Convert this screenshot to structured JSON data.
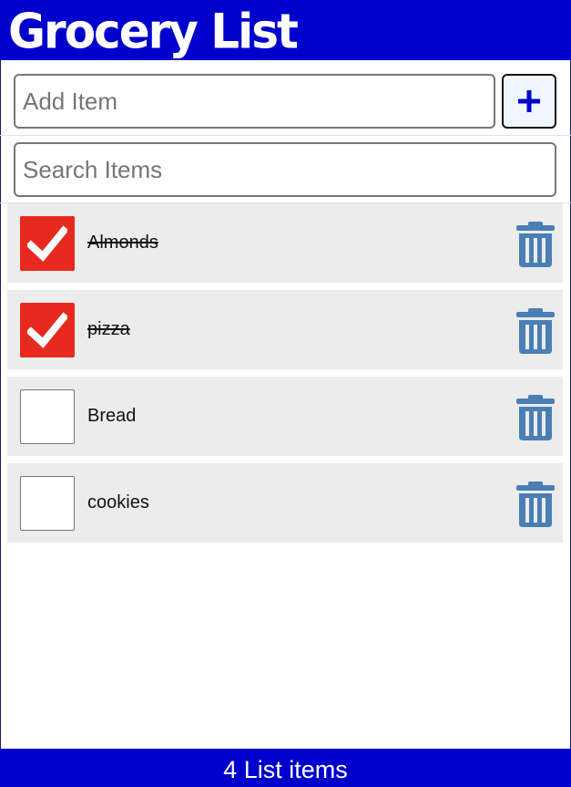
{
  "header": {
    "title": "Grocery List",
    "background": "#0000cc"
  },
  "add_item": {
    "placeholder": "Add Item",
    "value": "",
    "button_icon": "plus-icon"
  },
  "search": {
    "placeholder": "Search Items",
    "value": ""
  },
  "items": [
    {
      "label": "Almonds",
      "checked": true
    },
    {
      "label": "pizza",
      "checked": true
    },
    {
      "label": "Bread",
      "checked": false
    },
    {
      "label": "cookies",
      "checked": false
    }
  ],
  "colors": {
    "checked": "#e8291e",
    "trash": "#4a7fb5",
    "accent": "#0000cc"
  },
  "footer": {
    "text": "4 List items"
  }
}
